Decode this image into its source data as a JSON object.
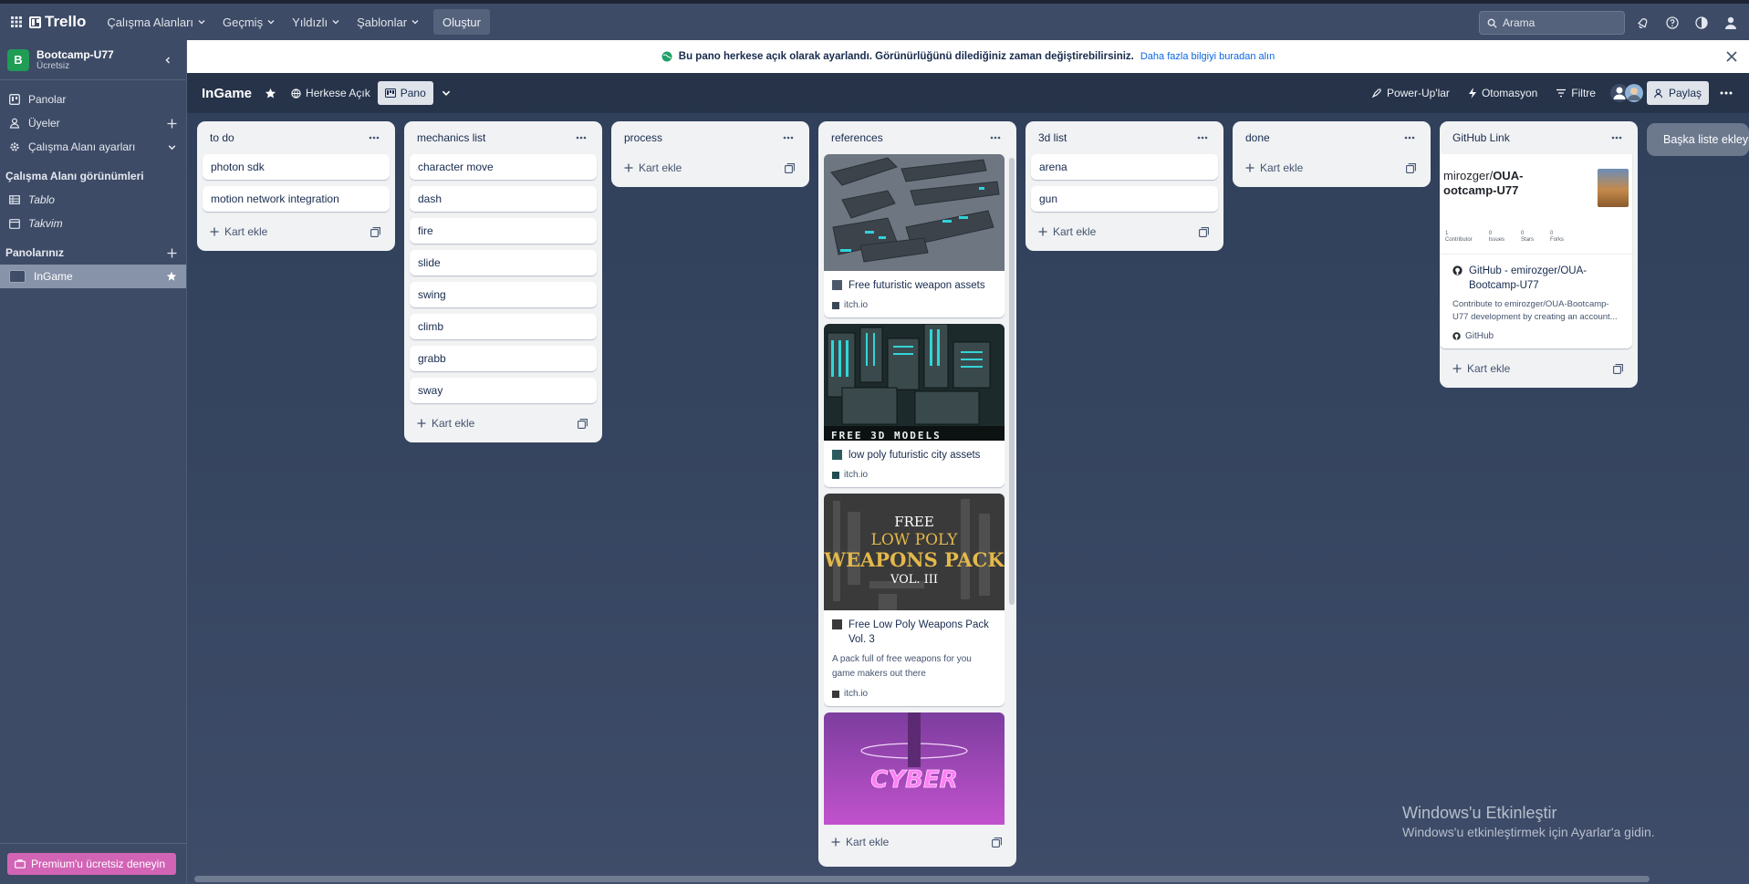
{
  "topbar": {
    "app_name": "Trello",
    "nav": [
      "Çalışma Alanları",
      "Geçmiş",
      "Yıldızlı",
      "Şablonlar"
    ],
    "create": "Oluştur",
    "search_placeholder": "Arama"
  },
  "sidebar": {
    "workspace_initial": "B",
    "workspace_name": "Bootcamp-U77",
    "workspace_plan": "Ücretsiz",
    "items": [
      {
        "label": "Panolar",
        "icon": "trello-board-icon"
      },
      {
        "label": "Üyeler",
        "icon": "person-icon"
      },
      {
        "label": "Çalışma Alanı ayarları",
        "icon": "gear-icon"
      }
    ],
    "views_heading": "Çalışma Alanı görünümleri",
    "views": [
      {
        "label": "Tablo",
        "icon": "table-icon"
      },
      {
        "label": "Takvim",
        "icon": "calendar-icon"
      }
    ],
    "boards_heading": "Panolarınız",
    "boards": [
      {
        "label": "InGame"
      }
    ],
    "premium": "Premium'u ücretsiz deneyin"
  },
  "banner": {
    "text": "Bu pano herkese açık olarak ayarlandı. Görünürlüğünü dilediğiniz zaman değiştirebilirsiniz.",
    "link": "Daha fazla bilgiyi buradan alın"
  },
  "board": {
    "title": "InGame",
    "visibility": "Herkese Açık",
    "view": "Pano",
    "powerups": "Power-Up'lar",
    "automation": "Otomasyon",
    "filter": "Filtre",
    "share": "Paylaş",
    "add_list": "Başka liste ekleyin",
    "add_card": "Kart ekle"
  },
  "lists": [
    {
      "title": "to do",
      "cards": [
        "photon sdk",
        "motion network integration"
      ]
    },
    {
      "title": "mechanics list",
      "cards": [
        "character move",
        "dash",
        "fire",
        "slide",
        "swing",
        "climb",
        "grabb",
        "sway"
      ]
    },
    {
      "title": "process",
      "cards": []
    },
    {
      "title": "references",
      "cards": []
    },
    {
      "title": "3d list",
      "cards": [
        "arena",
        "gun"
      ]
    },
    {
      "title": "done",
      "cards": []
    },
    {
      "title": "GitHub Link",
      "cards": []
    }
  ],
  "references": [
    {
      "title": "Free futuristic weapon assets",
      "source": "itch.io"
    },
    {
      "title": "low poly futuristic city assets",
      "source": "itch.io",
      "cover_text": "FREE 3D MODELS"
    },
    {
      "title": "Free Low Poly Weapons Pack Vol. 3",
      "desc": "A pack full of free weapons for you game makers out there",
      "source": "itch.io",
      "cover_lines": [
        "FREE",
        "LOW POLY",
        "WEAPONS PACK",
        "VOL. III"
      ]
    },
    {
      "cover_text": "CYBER"
    }
  ],
  "github_card": {
    "preview_user": "mirozger/",
    "preview_repo": "OUA-",
    "preview_repo2": "ootcamp-U77",
    "stats": [
      "1 Contributor",
      "0 Issues",
      "0 Stars",
      "0 Forks"
    ],
    "stat_values": [
      "1",
      "0",
      "0",
      "0"
    ],
    "stat_labels": [
      "Contributor",
      "Issues",
      "Stars",
      "Forks"
    ],
    "title": "GitHub - emirozger/OUA-Bootcamp-U77",
    "desc": "Contribute to emirozger/OUA-Bootcamp-U77 development by creating an account...",
    "source": "GitHub"
  },
  "watermark": {
    "line1": "Windows'u Etkinleştir",
    "line2": "Windows'u etkinleştirmek için Ayarlar'a gidin."
  },
  "colors": {
    "topbar": "#3d4b66",
    "premium": "#d264b6",
    "link": "#0c66e4",
    "workspace_avatar": "#1f9d55"
  }
}
